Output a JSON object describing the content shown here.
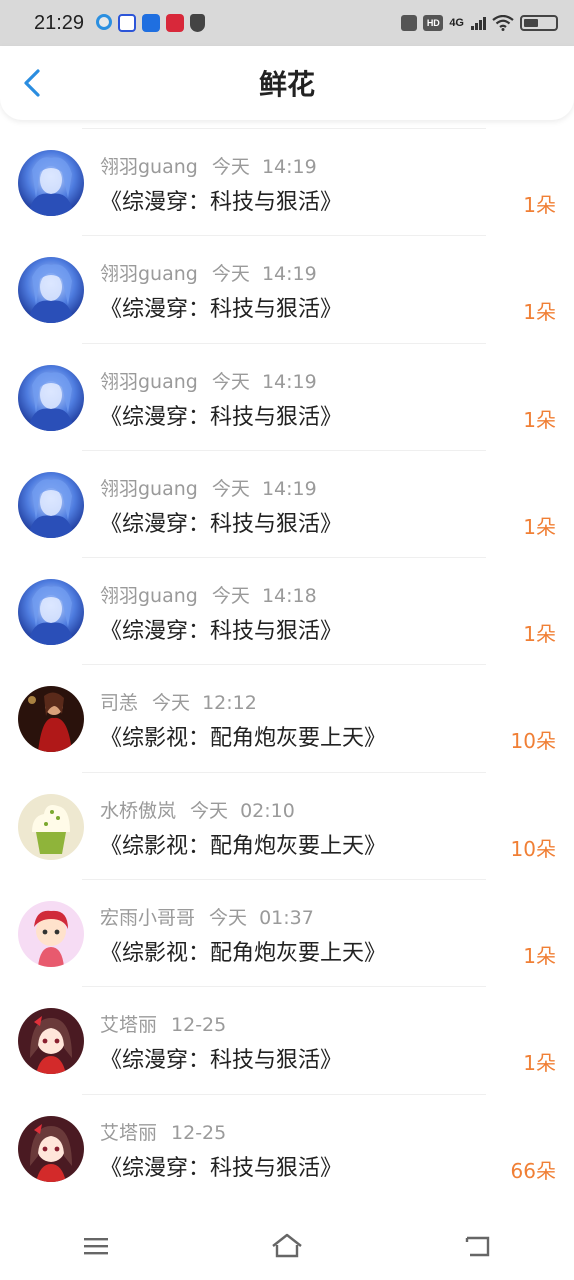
{
  "status_bar": {
    "time": "21:29",
    "network": "4G",
    "hd": "HD",
    "battery_level": 0.45,
    "app_icons": [
      "loop-icon",
      "baidu-paw-icon",
      "direction-app-icon",
      "heart-app-icon",
      "shield-icon"
    ]
  },
  "header": {
    "title": "鲜花"
  },
  "accent_color": "#f07f35",
  "records": [
    {
      "user": "翎羽guang",
      "time": "今天  14:19",
      "book": "《综漫穿：科技与狠活》",
      "count": "1朵",
      "avatar": "blue-hair-avatar"
    },
    {
      "user": "翎羽guang",
      "time": "今天  14:19",
      "book": "《综漫穿：科技与狠活》",
      "count": "1朵",
      "avatar": "blue-hair-avatar"
    },
    {
      "user": "翎羽guang",
      "time": "今天  14:19",
      "book": "《综漫穿：科技与狠活》",
      "count": "1朵",
      "avatar": "blue-hair-avatar"
    },
    {
      "user": "翎羽guang",
      "time": "今天  14:19",
      "book": "《综漫穿：科技与狠活》",
      "count": "1朵",
      "avatar": "blue-hair-avatar"
    },
    {
      "user": "翎羽guang",
      "time": "今天  14:18",
      "book": "《综漫穿：科技与狠活》",
      "count": "1朵",
      "avatar": "blue-hair-avatar"
    },
    {
      "user": "司恙",
      "time": "今天  12:12",
      "book": "《综影视：配角炮灰要上天》",
      "count": "10朵",
      "avatar": "red-dress-avatar"
    },
    {
      "user": "水桥傲岚",
      "time": "今天  02:10",
      "book": "《综影视：配角炮灰要上天》",
      "count": "10朵",
      "avatar": "cupcake-avatar"
    },
    {
      "user": "宏雨小哥哥",
      "time": "今天  01:37",
      "book": "《综影视：配角炮灰要上天》",
      "count": "1朵",
      "avatar": "cartoon-boy-avatar"
    },
    {
      "user": "艾塔丽",
      "time": "12-25",
      "book": "《综漫穿：科技与狠活》",
      "count": "1朵",
      "avatar": "anime-girl-avatar"
    },
    {
      "user": "艾塔丽",
      "time": "12-25",
      "book": "《综漫穿：科技与狠活》",
      "count": "66朵",
      "avatar": "anime-girl-avatar"
    }
  ],
  "nav_bar": {
    "icons": [
      "menu-icon",
      "home-icon",
      "back-icon"
    ]
  }
}
